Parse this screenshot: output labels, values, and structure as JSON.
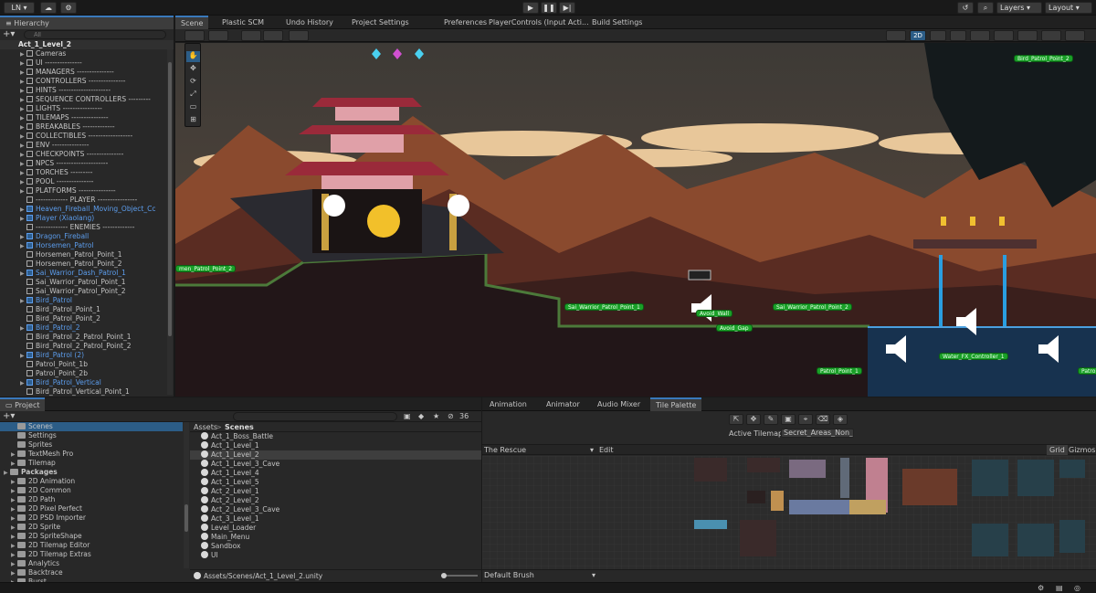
{
  "topbar": {
    "account": "LN ▾",
    "layers": "Layers",
    "layout": "Layout"
  },
  "hierarchy": {
    "title": "Hierarchy",
    "search_placeholder": "All",
    "scene": "Act_1_Level_2",
    "items": [
      {
        "label": "Cameras",
        "blue": false,
        "arrow": true
      },
      {
        "label": "UI ---------------",
        "blue": false,
        "arrow": true
      },
      {
        "label": "MANAGERS ---------------",
        "blue": false,
        "arrow": true
      },
      {
        "label": "CONTROLLERS ---------------",
        "blue": false,
        "arrow": true
      },
      {
        "label": "HINTS ---------------------",
        "blue": false,
        "arrow": true
      },
      {
        "label": "SEQUENCE CONTROLLERS ---------",
        "blue": false,
        "arrow": true
      },
      {
        "label": "LIGHTS ----------------",
        "blue": false,
        "arrow": true
      },
      {
        "label": "TILEMAPS ---------------",
        "blue": false,
        "arrow": true
      },
      {
        "label": "BREAKABLES -------------",
        "blue": false,
        "arrow": true
      },
      {
        "label": "COLLECTIBLES ------------------",
        "blue": false,
        "arrow": true
      },
      {
        "label": "ENV ---------------",
        "blue": false,
        "arrow": true
      },
      {
        "label": "CHECKPOINTS ---------------",
        "blue": false,
        "arrow": true
      },
      {
        "label": "NPCS ---------------------",
        "blue": false,
        "arrow": true
      },
      {
        "label": "TORCHES ---------",
        "blue": false,
        "arrow": true
      },
      {
        "label": "POOL ---------------",
        "blue": false,
        "arrow": true
      },
      {
        "label": "PLATFORMS ---------------",
        "blue": false,
        "arrow": true
      },
      {
        "label": "------------- PLAYER ----------------",
        "blue": false,
        "arrow": false
      },
      {
        "label": "Heaven_Fireball_Moving_Object_Cc",
        "blue": true,
        "arrow": true
      },
      {
        "label": "Player (Xiaolang)",
        "blue": true,
        "arrow": true
      },
      {
        "label": "------------- ENEMIES -------------",
        "blue": false,
        "arrow": false
      },
      {
        "label": "Dragon_Fireball",
        "blue": true,
        "arrow": true
      },
      {
        "label": "Horsemen_Patrol",
        "blue": true,
        "arrow": true
      },
      {
        "label": "Horsemen_Patrol_Point_1",
        "blue": false,
        "arrow": false
      },
      {
        "label": "Horsemen_Patrol_Point_2",
        "blue": false,
        "arrow": false
      },
      {
        "label": "Sai_Warrior_Dash_Patrol_1",
        "blue": true,
        "arrow": true
      },
      {
        "label": "Sai_Warrior_Patrol_Point_1",
        "blue": false,
        "arrow": false
      },
      {
        "label": "Sai_Warrior_Patrol_Point_2",
        "blue": false,
        "arrow": false
      },
      {
        "label": "Bird_Patrol",
        "blue": true,
        "arrow": true
      },
      {
        "label": "Bird_Patrol_Point_1",
        "blue": false,
        "arrow": false
      },
      {
        "label": "Bird_Patrol_Point_2",
        "blue": false,
        "arrow": false
      },
      {
        "label": "Bird_Patrol_2",
        "blue": true,
        "arrow": true
      },
      {
        "label": "Bird_Patrol_2_Patrol_Point_1",
        "blue": false,
        "arrow": false
      },
      {
        "label": "Bird_Patrol_2_Patrol_Point_2",
        "blue": false,
        "arrow": false
      },
      {
        "label": "Bird_Patrol (2)",
        "blue": true,
        "arrow": true
      },
      {
        "label": "Patrol_Point_1b",
        "blue": false,
        "arrow": false
      },
      {
        "label": "Patrol_Point_2b",
        "blue": false,
        "arrow": false
      },
      {
        "label": "Bird_Patrol_Vertical",
        "blue": true,
        "arrow": true
      },
      {
        "label": "Bird_Patrol_Vertical_Point_1",
        "blue": false,
        "arrow": false
      }
    ]
  },
  "scene_tabs": [
    "Scene",
    "Plastic SCM",
    "Undo History",
    "Project Settings",
    "Preferences",
    "PlayerControls (Input Acti...",
    "Build Settings"
  ],
  "scene_toolbar": {
    "mode_2d": "2D"
  },
  "scene_labels": {
    "bird_patrol_point_2": "Bird_Patrol_Point_2",
    "horsemen_point": "men_Patrol_Point_2",
    "sai_point_1": "Sai_Warrior_Patrol_Point_1",
    "sai_point_2": "Sai_Warrior_Patrol_Point_2",
    "avoid_wall": "Avoid_Wall",
    "avoid_gap": "Avoid_Gap",
    "water_controller": "Water_FX_Controller_1",
    "patrol_point": "Patrol_Point_1",
    "patrol_point_edge": "Patro"
  },
  "project": {
    "title": "Project",
    "search_value": "",
    "count": "36",
    "tree": [
      {
        "label": "Scenes",
        "indent": 2,
        "sel": true
      },
      {
        "label": "Settings",
        "indent": 2
      },
      {
        "label": "Sprites",
        "indent": 2
      },
      {
        "label": "TextMesh Pro",
        "indent": 2,
        "arrow": true
      },
      {
        "label": "Tilemap",
        "indent": 2,
        "arrow": true
      },
      {
        "label": "Packages",
        "indent": 0,
        "bold": true,
        "arrow": true
      },
      {
        "label": "2D Animation",
        "indent": 2,
        "arrow": true
      },
      {
        "label": "2D Common",
        "indent": 2,
        "arrow": true
      },
      {
        "label": "2D Path",
        "indent": 2,
        "arrow": true
      },
      {
        "label": "2D Pixel Perfect",
        "indent": 2,
        "arrow": true
      },
      {
        "label": "2D PSD Importer",
        "indent": 2,
        "arrow": true
      },
      {
        "label": "2D Sprite",
        "indent": 2,
        "arrow": true
      },
      {
        "label": "2D SpriteShape",
        "indent": 2,
        "arrow": true
      },
      {
        "label": "2D Tilemap Editor",
        "indent": 2,
        "arrow": true
      },
      {
        "label": "2D Tilemap Extras",
        "indent": 2,
        "arrow": true
      },
      {
        "label": "Analytics",
        "indent": 2,
        "arrow": true
      },
      {
        "label": "Backtrace",
        "indent": 2,
        "arrow": true
      },
      {
        "label": "Burst",
        "indent": 2,
        "arrow": true
      }
    ],
    "breadcrumb": [
      "Assets",
      ">",
      "Scenes"
    ],
    "files": [
      "Act_1_Boss_Battle",
      "Act_1_Level_1",
      "Act_1_Level_2",
      "Act_1_Level_3_Cave",
      "Act_1_Level_4",
      "Act_1_Level_5",
      "Act_2_Level_1",
      "Act_2_Level_2",
      "Act_2_Level_3_Cave",
      "Act_3_Level_1",
      "Level_Loader",
      "Main_Menu",
      "Sandbox",
      "UI"
    ],
    "selected_file": "Act_1_Level_2",
    "status_path": "Assets/Scenes/Act_1_Level_2.unity"
  },
  "palette": {
    "tabs": [
      "Animation",
      "Animator",
      "Audio Mixer",
      "Tile Palette"
    ],
    "active_tilemap_label": "Active Tilemap",
    "active_tilemap_value": "Secret_Areas_Non_(",
    "palette_name": "The Rescue",
    "edit": "Edit",
    "grid": "Grid",
    "gizmos": "Gizmos",
    "brush": "Default Brush"
  }
}
